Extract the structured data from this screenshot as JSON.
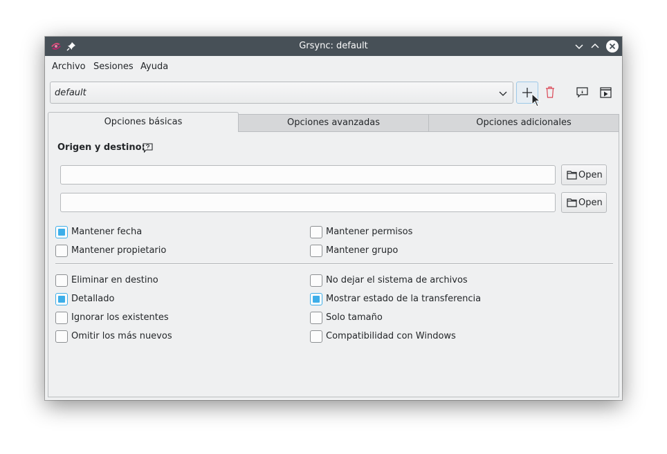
{
  "window": {
    "title": "Grsync: default"
  },
  "menu": {
    "items": [
      "Archivo",
      "Sesiones",
      "Ayuda"
    ]
  },
  "session": {
    "value": "default"
  },
  "tabs": [
    {
      "label": "Opciones básicas",
      "active": true
    },
    {
      "label": "Opciones avanzadas",
      "active": false
    },
    {
      "label": "Opciones adicionales",
      "active": false
    }
  ],
  "basic": {
    "section_title": "Origen y destino:",
    "source": {
      "value": "",
      "open_label": "Open"
    },
    "destination": {
      "value": "",
      "open_label": "Open"
    },
    "options": [
      {
        "label": "Mantener fecha",
        "checked": true
      },
      {
        "label": "Mantener permisos",
        "checked": false
      },
      {
        "label": "Mantener propietario",
        "checked": false
      },
      {
        "label": "Mantener grupo",
        "checked": false
      },
      {
        "label": "Eliminar en destino",
        "checked": false
      },
      {
        "label": "No dejar el sistema de archivos",
        "checked": false
      },
      {
        "label": "Detallado",
        "checked": true
      },
      {
        "label": "Mostrar estado de la transferencia",
        "checked": true
      },
      {
        "label": "Ignorar los existentes",
        "checked": false
      },
      {
        "label": "Solo tamaño",
        "checked": false
      },
      {
        "label": "Omitir los más nuevos",
        "checked": false
      },
      {
        "label": "Compatibilidad con Windows",
        "checked": false
      }
    ]
  },
  "colors": {
    "titlebar": "#475057",
    "accent": "#3daee9",
    "window_bg": "#eff0f1",
    "delete_icon": "#da4453"
  },
  "icons": {
    "app": "grsync-app-icon",
    "pin": "pin-icon",
    "minimize": "chevron-down-icon",
    "maximize": "chevron-up-icon",
    "close": "close-icon",
    "add": "plus-icon",
    "delete": "trash-icon",
    "info": "info-icon",
    "run": "play-icon",
    "help": "help-icon",
    "folder": "folder-icon"
  }
}
